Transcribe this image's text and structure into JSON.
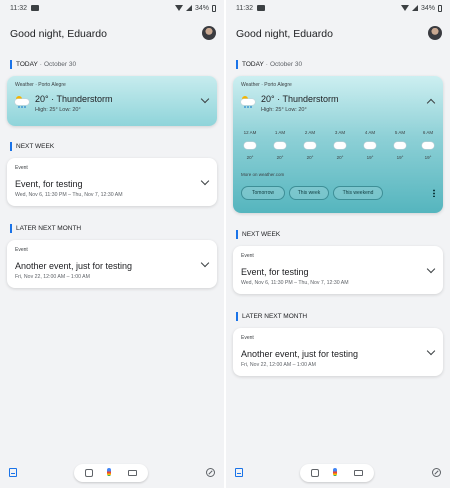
{
  "status_bar": {
    "time": "11:32",
    "battery": "34%"
  },
  "greeting": "Good night, Eduardo",
  "sections": {
    "today": {
      "label": "TODAY",
      "date": "October 30"
    },
    "next_week": {
      "label": "NEXT WEEK"
    },
    "later_next_month": {
      "label": "LATER NEXT MONTH"
    }
  },
  "weather": {
    "header": "Weather · Porto Alegre",
    "condition": "20° · Thunderstorm",
    "high_low": "High: 25° Low: 20°",
    "hourly": [
      {
        "time": "12 AM",
        "temp": "20°",
        "icon": "cloud-icon"
      },
      {
        "time": "1 AM",
        "temp": "20°",
        "icon": "cloud-icon"
      },
      {
        "time": "2 AM",
        "temp": "20°",
        "icon": "cloud-icon"
      },
      {
        "time": "3 AM",
        "temp": "20°",
        "icon": "cloud-icon"
      },
      {
        "time": "4 AM",
        "temp": "19°",
        "icon": "cloud-icon"
      },
      {
        "time": "5 AM",
        "temp": "19°",
        "icon": "cloud-icon"
      },
      {
        "time": "6 AM",
        "temp": "19°",
        "icon": "partly-sunny-icon"
      }
    ],
    "more_link": "More on weather.com",
    "chips": [
      "Tomorrow",
      "This week",
      "This weekend"
    ]
  },
  "events": [
    {
      "tag": "Event",
      "title": "Event, for testing",
      "when": "Wed, Nov 6, 11:30 PM – Thu, Nov 7, 12:30 AM"
    },
    {
      "tag": "Event",
      "title": "Another event, just for testing",
      "when": "Fri, Nov 22, 12:00 AM – 1:00 AM"
    }
  ],
  "colors": {
    "accent": "#1a73e8",
    "weather_card": "#8fd4da",
    "background": "#f2f3f5"
  }
}
